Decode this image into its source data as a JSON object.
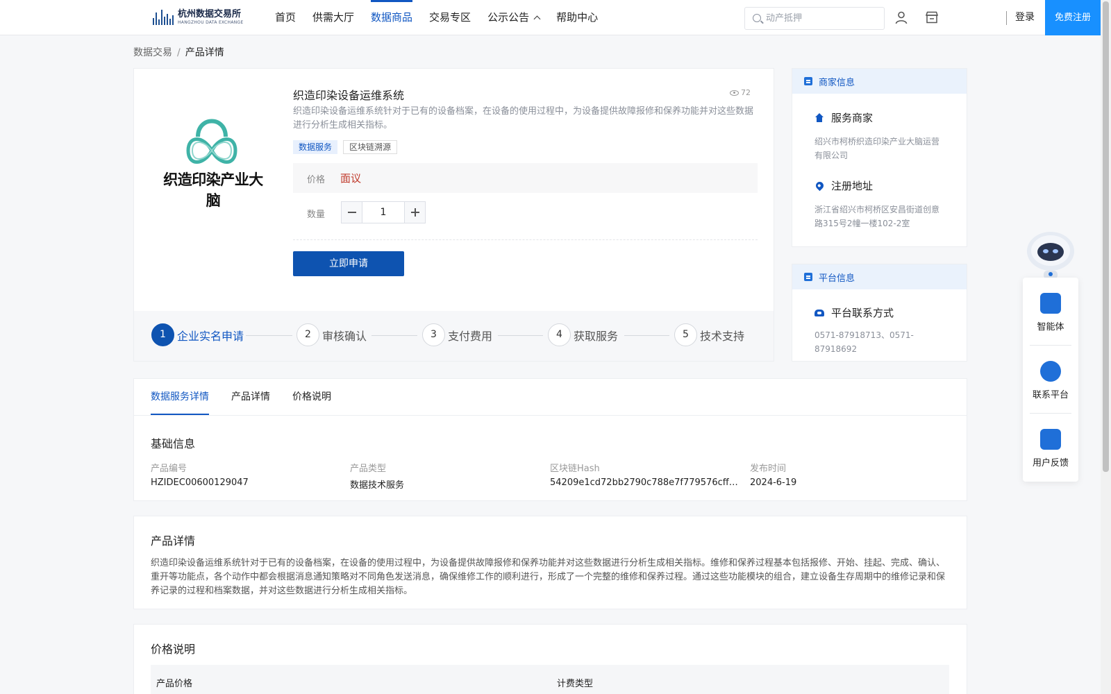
{
  "header": {
    "logo_cn": "杭州数据交易所",
    "logo_en": "HANGZHOU DATA EXCHANGE",
    "nav": [
      {
        "label": "首页"
      },
      {
        "label": "供需大厅"
      },
      {
        "label": "数据商品"
      },
      {
        "label": "交易专区"
      },
      {
        "label": "公示公告"
      },
      {
        "label": "帮助中心"
      }
    ],
    "active_nav": "数据商品",
    "search_placeholder": "动产抵押",
    "login": "登录",
    "register": "免费注册"
  },
  "breadcrumb": {
    "root": "数据交易",
    "separator": "/",
    "current": "产品详情"
  },
  "product": {
    "logo_text": "织造印染产业大脑",
    "title": "织造印染设备运维系统",
    "views": "72",
    "description": "织造印染设备运维系统针对于已有的设备档案，在设备的使用过程中，为设备提供故障报修和保养功能并对这些数据进行分析生成相关指标。",
    "tags": [
      "数据服务",
      "区块链溯源"
    ],
    "price_label": "价格",
    "price_value": "面议",
    "quantity_label": "数量",
    "quantity_value": "1",
    "apply_button": "立即申请",
    "steps": [
      {
        "num": "1",
        "label": "企业实名申请"
      },
      {
        "num": "2",
        "label": "审核确认"
      },
      {
        "num": "3",
        "label": "支付费用"
      },
      {
        "num": "4",
        "label": "获取服务"
      },
      {
        "num": "5",
        "label": "技术支持"
      }
    ]
  },
  "merchant": {
    "header": "商家信息",
    "service_label": "服务商家",
    "service_value": "绍兴市柯桥织造印染产业大脑运营有限公司",
    "address_label": "注册地址",
    "address_value": "浙江省绍兴市柯桥区安昌街道创意路315号2幢一楼102-2室"
  },
  "platform": {
    "header": "平台信息",
    "contact_label": "平台联系方式",
    "contact_value": "0571-87918713、0571-87918692"
  },
  "float_panel": [
    {
      "label": "智能体"
    },
    {
      "label": "联系平台"
    },
    {
      "label": "用户反馈"
    }
  ],
  "tabs": [
    {
      "label": "数据服务详情"
    },
    {
      "label": "产品详情"
    },
    {
      "label": "价格说明"
    }
  ],
  "basic_info": {
    "title": "基础信息",
    "fields": [
      {
        "key": "产品编号",
        "value": "HZIDEC00600129047"
      },
      {
        "key": "产品类型",
        "value": "数据技术服务"
      },
      {
        "key": "区块链Hash",
        "value": "54209e1cd72bb2790c788e7f779576cff6c..."
      },
      {
        "key": "发布时间",
        "value": "2024-6-19"
      }
    ]
  },
  "detail": {
    "title": "产品详情",
    "text": "织造印染设备运维系统针对于已有的设备档案，在设备的使用过程中，为设备提供故障报修和保养功能并对这些数据进行分析生成相关指标。维修和保养过程基本包括报修、开始、挂起、完成、确认、重开等功能点，各个动作中都会根据消息通知策略对不同角色发送消息，确保维修工作的顺利进行，形成了一个完整的维修和保养过程。通过这些功能模块的组合，建立设备生存周期中的维修记录和保养记录的过程和档案数据，并对这些数据进行分析生成相关指标。"
  },
  "pricing": {
    "title": "价格说明",
    "col_price": "产品价格",
    "col_billing": "计费类型"
  },
  "colors": {
    "primary": "#1157c2",
    "button": "#0e53b0",
    "register": "#1890ff",
    "price": "#c0392b",
    "logo_teal": "#3fb3a7"
  }
}
